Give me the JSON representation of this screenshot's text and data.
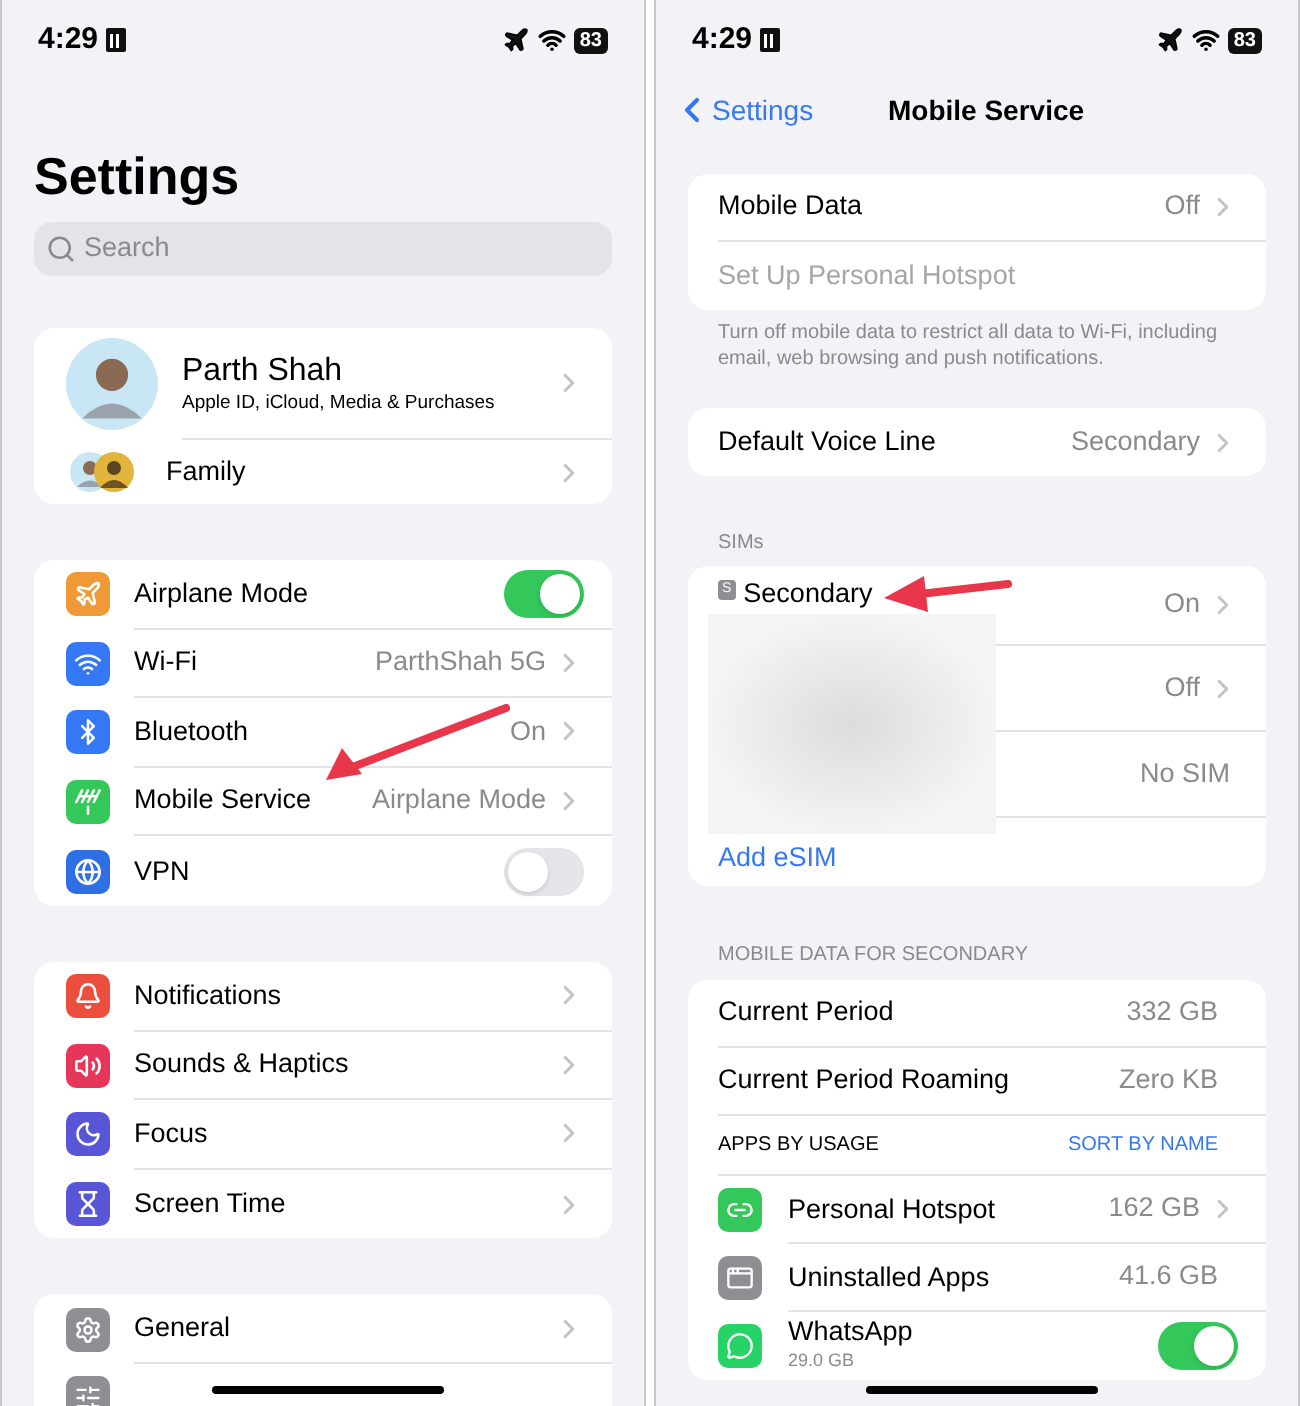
{
  "left": {
    "status_bar": {
      "time": "4:29",
      "battery": "83"
    },
    "title": "Settings",
    "search": {
      "placeholder": "Search"
    },
    "profile": {
      "name": "Parth Shah",
      "subtitle": "Apple ID, iCloud, Media & Purchases",
      "family": "Family"
    },
    "groups": [
      [
        {
          "kind": "toggle",
          "label": "Airplane Mode",
          "on": true
        },
        {
          "kind": "link",
          "label": "Wi-Fi",
          "value": "ParthShah 5G"
        },
        {
          "kind": "link",
          "label": "Bluetooth",
          "value": "On"
        },
        {
          "kind": "link",
          "label": "Mobile Service",
          "value": "Airplane Mode"
        },
        {
          "kind": "toggle",
          "label": "VPN",
          "on": false
        }
      ],
      [
        {
          "kind": "link",
          "label": "Notifications"
        },
        {
          "kind": "link",
          "label": "Sounds & Haptics"
        },
        {
          "kind": "link",
          "label": "Focus"
        },
        {
          "kind": "link",
          "label": "Screen Time"
        }
      ],
      [
        {
          "kind": "link",
          "label": "General"
        }
      ]
    ]
  },
  "right": {
    "status_bar": {
      "time": "4:29",
      "battery": "83"
    },
    "nav": {
      "back": "Settings",
      "title": "Mobile Service"
    },
    "data_card": [
      {
        "label": "Mobile Data",
        "value": "Off",
        "disabled": false
      },
      {
        "label": "Set Up Personal Hotspot",
        "disabled": true
      }
    ],
    "data_footer": "Turn off mobile data to restrict all data to Wi-Fi, including email, web browsing and push notifications.",
    "voice_line": {
      "label": "Default Voice Line",
      "value": "Secondary"
    },
    "sims_header": "SIMs",
    "sims": [
      {
        "badge": "S",
        "label": "Secondary",
        "value": "On"
      },
      {
        "value": "Off"
      },
      {
        "value": "No SIM"
      }
    ],
    "add_esim": "Add eSIM",
    "usage_header": "MOBILE DATA FOR SECONDARY",
    "usage": [
      {
        "label": "Current Period",
        "value": "332 GB"
      },
      {
        "label": "Current Period Roaming",
        "value": "Zero KB"
      }
    ],
    "apps_header": {
      "label": "APPS BY USAGE",
      "action": "SORT BY NAME"
    },
    "apps": [
      {
        "kind": "link",
        "label": "Personal Hotspot",
        "value": "162 GB"
      },
      {
        "kind": "plain",
        "label": "Uninstalled Apps",
        "value": "41.6 GB"
      },
      {
        "kind": "toggle",
        "label": "WhatsApp",
        "sub": "29.0 GB",
        "on": true
      }
    ]
  }
}
